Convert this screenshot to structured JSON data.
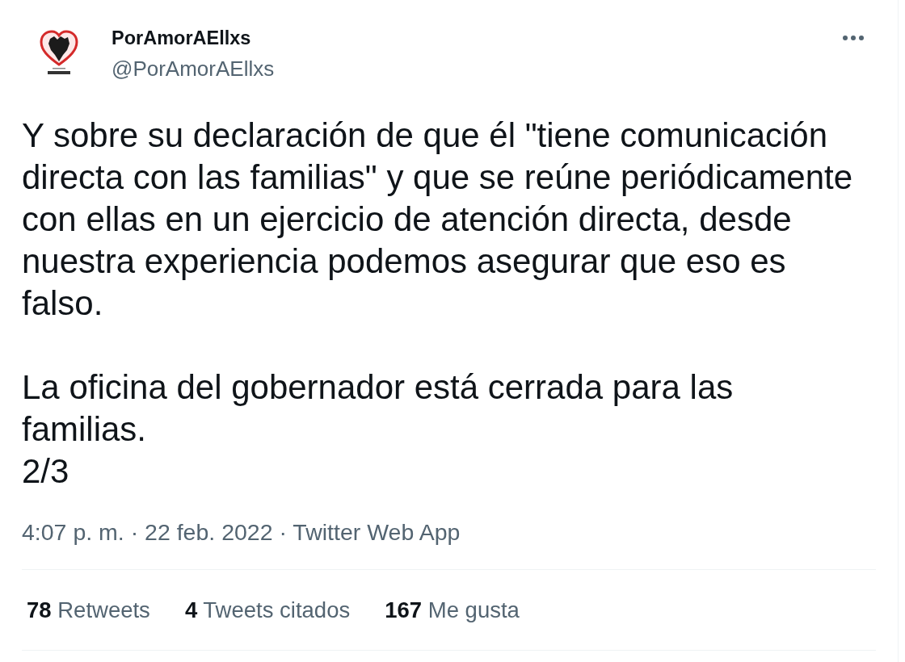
{
  "author": {
    "display_name": "PorAmorAEllxs",
    "handle": "@PorAmorAEllxs"
  },
  "tweet": {
    "text": "Y sobre su declaración de que él \"tiene comunicación directa con las familias\" y que se reúne periódicamente con ellas en un ejercicio de atención directa, desde nuestra experiencia podemos asegurar que eso es falso.\n\nLa oficina del gobernador está cerrada para las familias.\n2/3",
    "timestamp": "4:07 p. m. · 22 feb. 2022 · Twitter Web App"
  },
  "stats": [
    {
      "count": "78",
      "label": "Retweets"
    },
    {
      "count": "4",
      "label": "Tweets citados"
    },
    {
      "count": "167",
      "label": "Me gusta"
    }
  ]
}
